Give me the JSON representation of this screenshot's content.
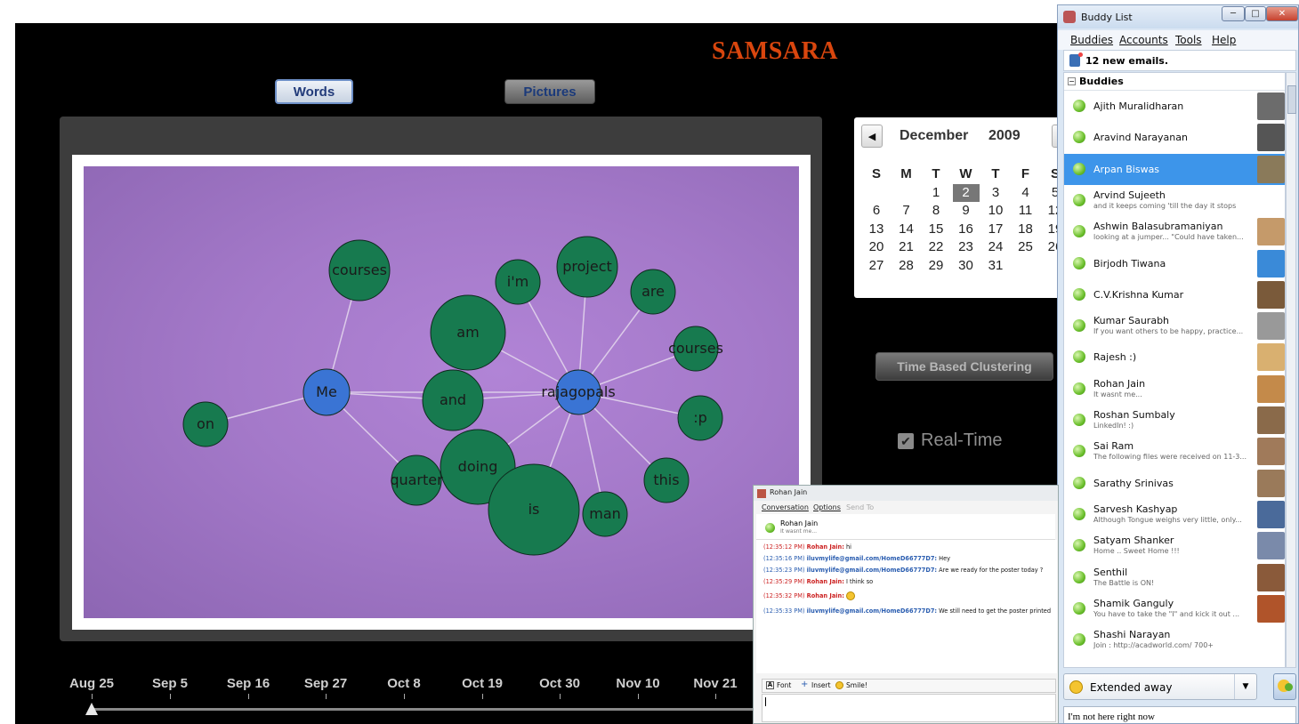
{
  "app": {
    "brand": "SAMSARA",
    "tabs": {
      "words": "Words",
      "pictures": "Pictures"
    },
    "graph": {
      "nodes": [
        {
          "id": "courses1",
          "label": "courses",
          "color": "green",
          "size": "md"
        },
        {
          "id": "im",
          "label": "i'm",
          "color": "green",
          "size": "sm"
        },
        {
          "id": "project",
          "label": "project",
          "color": "green",
          "size": "md"
        },
        {
          "id": "are",
          "label": "are",
          "color": "green",
          "size": "sm"
        },
        {
          "id": "am",
          "label": "am",
          "color": "green",
          "size": "lg"
        },
        {
          "id": "courses2",
          "label": "courses",
          "color": "green",
          "size": "sm"
        },
        {
          "id": "me",
          "label": "Me",
          "color": "blue",
          "size": "sm"
        },
        {
          "id": "and",
          "label": "and",
          "color": "green",
          "size": "md"
        },
        {
          "id": "rajagopals",
          "label": "rajagopals",
          "color": "blue",
          "size": "sm"
        },
        {
          "id": "on",
          "label": "on",
          "color": "green",
          "size": "sm"
        },
        {
          "id": "p",
          "label": ":p",
          "color": "green",
          "size": "sm"
        },
        {
          "id": "doing",
          "label": "doing",
          "color": "green",
          "size": "lg"
        },
        {
          "id": "quarter",
          "label": "quarter",
          "color": "green",
          "size": "sm"
        },
        {
          "id": "this",
          "label": "this",
          "color": "green",
          "size": "sm"
        },
        {
          "id": "is",
          "label": "is",
          "color": "green",
          "size": "xl"
        },
        {
          "id": "man",
          "label": "man",
          "color": "green",
          "size": "sm"
        }
      ],
      "edges": [
        [
          "me",
          "courses1"
        ],
        [
          "me",
          "on"
        ],
        [
          "me",
          "and"
        ],
        [
          "me",
          "quarter"
        ],
        [
          "me",
          "rajagopals"
        ],
        [
          "rajagopals",
          "im"
        ],
        [
          "rajagopals",
          "project"
        ],
        [
          "rajagopals",
          "are"
        ],
        [
          "rajagopals",
          "am"
        ],
        [
          "rajagopals",
          "courses2"
        ],
        [
          "rajagopals",
          "and"
        ],
        [
          "rajagopals",
          "p"
        ],
        [
          "rajagopals",
          "doing"
        ],
        [
          "rajagopals",
          "is"
        ],
        [
          "rajagopals",
          "man"
        ],
        [
          "rajagopals",
          "this"
        ]
      ]
    },
    "calendar": {
      "month": "December",
      "year": "2009",
      "weekdays": [
        "S",
        "M",
        "T",
        "W",
        "T",
        "F",
        "S"
      ],
      "weeks": [
        [
          "",
          "",
          "1",
          "2",
          "3",
          "4",
          "5"
        ],
        [
          "6",
          "7",
          "8",
          "9",
          "10",
          "11",
          "12"
        ],
        [
          "13",
          "14",
          "15",
          "16",
          "17",
          "18",
          "19"
        ],
        [
          "20",
          "21",
          "22",
          "23",
          "24",
          "25",
          "26"
        ],
        [
          "27",
          "28",
          "29",
          "30",
          "31",
          "",
          ""
        ]
      ],
      "selected_day": "2"
    },
    "time_clustering_button": "Time Based Clustering",
    "realtime": {
      "label": "Real-Time",
      "checked": true
    },
    "timeline": {
      "labels": [
        "Aug 25",
        "Sep 5",
        "Sep 16",
        "Sep 27",
        "Oct 8",
        "Oct 19",
        "Oct 30",
        "Nov 10",
        "Nov 21"
      ],
      "position": 0
    }
  },
  "buddy_list": {
    "title": "Buddy List",
    "menu": [
      "Buddies",
      "Accounts",
      "Tools",
      "Help"
    ],
    "emails": "12 new emails.",
    "group": "Buddies",
    "buddies": [
      {
        "name": "Ajith Muralidharan",
        "status": "",
        "avatar": "#6c6c6c"
      },
      {
        "name": "Aravind Narayanan",
        "status": "",
        "avatar": "#555"
      },
      {
        "name": "Arpan Biswas",
        "status": "",
        "avatar": "#8a7a5a",
        "selected": true
      },
      {
        "name": "Arvind Sujeeth",
        "status": "and it keeps coming 'till the day it stops",
        "avatar": ""
      },
      {
        "name": "Ashwin Balasubramaniyan",
        "status": "looking at a jumper... \"Could have taken...",
        "avatar": "#c59a6a"
      },
      {
        "name": "Birjodh Tiwana",
        "status": "",
        "avatar": "#3a8ad8"
      },
      {
        "name": "C.V.Krishna Kumar",
        "status": "",
        "avatar": "#7a5a3a"
      },
      {
        "name": "Kumar Saurabh",
        "status": "If you want others to be happy, practice...",
        "avatar": "#999"
      },
      {
        "name": "Rajesh :)",
        "status": "",
        "avatar": "#d9b070"
      },
      {
        "name": "Rohan Jain",
        "status": "It wasnt me...",
        "avatar": "#c48a4a"
      },
      {
        "name": "Roshan Sumbaly",
        "status": "LinkedIn! :)",
        "avatar": "#8a6a4a"
      },
      {
        "name": "Sai Ram",
        "status": "The following files were received on 11-3...",
        "avatar": "#a07a5a"
      },
      {
        "name": "Sarathy Srinivas",
        "status": "",
        "avatar": "#9a7a5a"
      },
      {
        "name": "Sarvesh Kashyap",
        "status": "Although Tongue weighs very little, only...",
        "avatar": "#4a6a9a"
      },
      {
        "name": "Satyam Shanker",
        "status": "Home .. Sweet Home !!!",
        "avatar": "#7a8aaa"
      },
      {
        "name": "Senthil",
        "status": "The Battle is ON!",
        "avatar": "#8a5a3a"
      },
      {
        "name": "Shamik Ganguly",
        "status": "You have to take the \"I\" and kick it out ...",
        "avatar": "#b0542a"
      },
      {
        "name": "Shashi Narayan",
        "status": "Join : http://acadworld.com/  700+",
        "avatar": ""
      }
    ],
    "status_select": "Extended away",
    "away_message": "I'm not here right now"
  },
  "chat": {
    "title": "Rohan Jain",
    "menu": [
      "Conversation",
      "Options",
      "Send To"
    ],
    "contact_name": "Rohan Jain",
    "contact_status": "It wasnt me...",
    "messages": [
      {
        "time": "(12:35:12 PM)",
        "who": "Rohan Jain:",
        "text": " hi",
        "color": "red"
      },
      {
        "time": "(12:35:16 PM)",
        "who": "iluvmylife@gmail.com/HomeD66777D7:",
        "text": " Hey",
        "color": "blue"
      },
      {
        "time": "(12:35:23 PM)",
        "who": "iluvmylife@gmail.com/HomeD66777D7:",
        "text": " Are we ready for the poster today ?",
        "color": "blue"
      },
      {
        "time": "(12:35:29 PM)",
        "who": "Rohan Jain:",
        "text": " I think so",
        "color": "red"
      },
      {
        "time": "(12:35:32 PM)",
        "who": "Rohan Jain:",
        "text": "",
        "color": "red",
        "emoticon": true
      },
      {
        "time": "(12:35:33 PM)",
        "who": "iluvmylife@gmail.com/HomeD66777D7:",
        "text": " We still need to get the poster printed",
        "color": "blue"
      }
    ],
    "toolbar": [
      "Font",
      "Insert",
      "Smile!"
    ]
  }
}
